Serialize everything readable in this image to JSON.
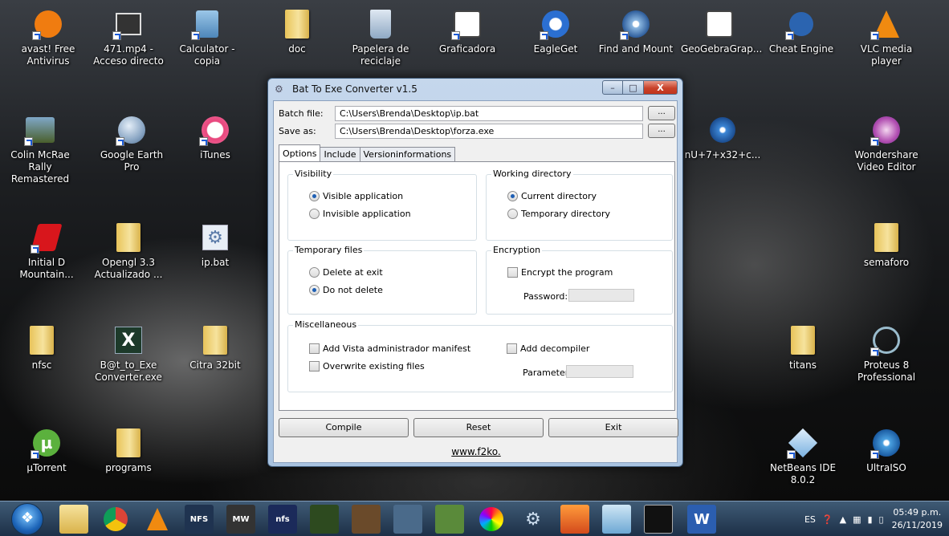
{
  "desktop_icons": [
    {
      "label": "avast! Free Antivirus"
    },
    {
      "label": "471.mp4 - Acceso directo"
    },
    {
      "label": "Calculator - copia"
    },
    {
      "label": "doc"
    },
    {
      "label": "Papelera de reciclaje"
    },
    {
      "label": "Graficadora"
    },
    {
      "label": "EagleGet"
    },
    {
      "label": "Find and Mount"
    },
    {
      "label": "GeoGebraGrap..."
    },
    {
      "label": "Cheat Engine"
    },
    {
      "label": "VLC media player"
    },
    {
      "label": "Colin McRae Rally Remastered"
    },
    {
      "label": "Google Earth Pro"
    },
    {
      "label": "iTunes"
    },
    {
      "label": "nU+7+x32+c..."
    },
    {
      "label": "Wondershare Video Editor"
    },
    {
      "label": "Initial D Mountain..."
    },
    {
      "label": "Opengl 3.3 Actualizado ..."
    },
    {
      "label": "ip.bat"
    },
    {
      "label": "semaforo"
    },
    {
      "label": "nfsc"
    },
    {
      "label": "B@t_to_Exe Converter.exe"
    },
    {
      "label": "Citra 32bit"
    },
    {
      "label": "titans"
    },
    {
      "label": "Proteus 8 Professional"
    },
    {
      "label": "µTorrent"
    },
    {
      "label": "programs"
    },
    {
      "label": "NetBeans IDE 8.0.2"
    },
    {
      "label": "UltraISO"
    }
  ],
  "window": {
    "title": "Bat To Exe Converter v1.5",
    "min_glyph": "–",
    "max_glyph": "□",
    "close_glyph": "X",
    "batch_label": "Batch file:",
    "batch_value": "C:\\Users\\Brenda\\Desktop\\ip.bat",
    "save_label": "Save as:",
    "save_value": "C:\\Users\\Brenda\\Desktop\\forza.exe",
    "browse_label": "...",
    "tabs": [
      "Options",
      "Include",
      "Versioninformations"
    ],
    "visibility": {
      "title": "Visibility",
      "visible": "Visible application",
      "invisible": "Invisible application"
    },
    "working_dir": {
      "title": "Working directory",
      "current": "Current directory",
      "temporary": "Temporary directory"
    },
    "temp_files": {
      "title": "Temporary files",
      "delete": "Delete at exit",
      "keep": "Do not delete"
    },
    "encryption": {
      "title": "Encryption",
      "encrypt": "Encrypt the program",
      "password_label": "Password:"
    },
    "misc": {
      "title": "Miscellaneous",
      "manifest": "Add Vista administrador manifest",
      "overwrite": "Overwrite existing files",
      "decompiler": "Add decompiler",
      "parameter_label": "Parameter"
    },
    "buttons": {
      "compile": "Compile",
      "reset": "Reset",
      "exit": "Exit"
    },
    "website": "www.f2ko."
  },
  "taskbar": {
    "apps": [
      "NFS",
      "MW",
      "nfs"
    ],
    "language": "ES",
    "time": "05:49 p.m.",
    "date": "26/11/2019"
  }
}
